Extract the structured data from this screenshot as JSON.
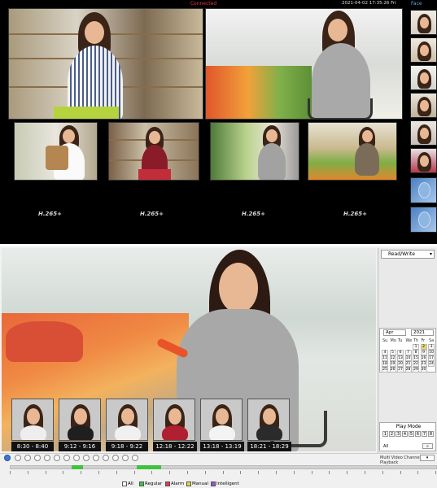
{
  "live": {
    "status": "Connected",
    "datetime": "2021-04-02 17:35:26 Fri",
    "face_title": "Face",
    "codecs": [
      "H.265+",
      "H.265+",
      "H.265+",
      "H.265+"
    ]
  },
  "playback": {
    "mode_select": "Read/Write",
    "calendar": {
      "month": "Apr",
      "year": "2021",
      "weekdays": [
        "Su",
        "Mo",
        "Tu",
        "We",
        "Th",
        "Fr",
        "Sa"
      ],
      "days": [
        "",
        "",
        "",
        "",
        "1",
        "2",
        "3",
        "4",
        "5",
        "6",
        "7",
        "8",
        "9",
        "10",
        "11",
        "12",
        "13",
        "14",
        "15",
        "16",
        "17",
        "18",
        "19",
        "20",
        "21",
        "22",
        "23",
        "24",
        "25",
        "26",
        "27",
        "28",
        "29",
        "30"
      ]
    },
    "play_mode": {
      "title": "Play Mode",
      "numbers": [
        "1",
        "2",
        "3",
        "4",
        "5",
        "6",
        "7",
        "8"
      ],
      "all_label": "All"
    },
    "thumbnails": [
      "8:30 - 8:40",
      "9:12 - 9:16",
      "9:18 - 9:22",
      "12:18 - 12:22",
      "13:18 - 13:19",
      "18:21 - 18:29"
    ],
    "channel_text": "Multi Video Channels Playback",
    "legend": [
      {
        "label": "All",
        "color": "#ffffff"
      },
      {
        "label": "Regular",
        "color": "#3ec43e"
      },
      {
        "label": "Alarm",
        "color": "#e83a3a"
      },
      {
        "label": "Manual",
        "color": "#e8d33a"
      },
      {
        "label": "Intelligent",
        "color": "#9b4fd0"
      }
    ]
  }
}
